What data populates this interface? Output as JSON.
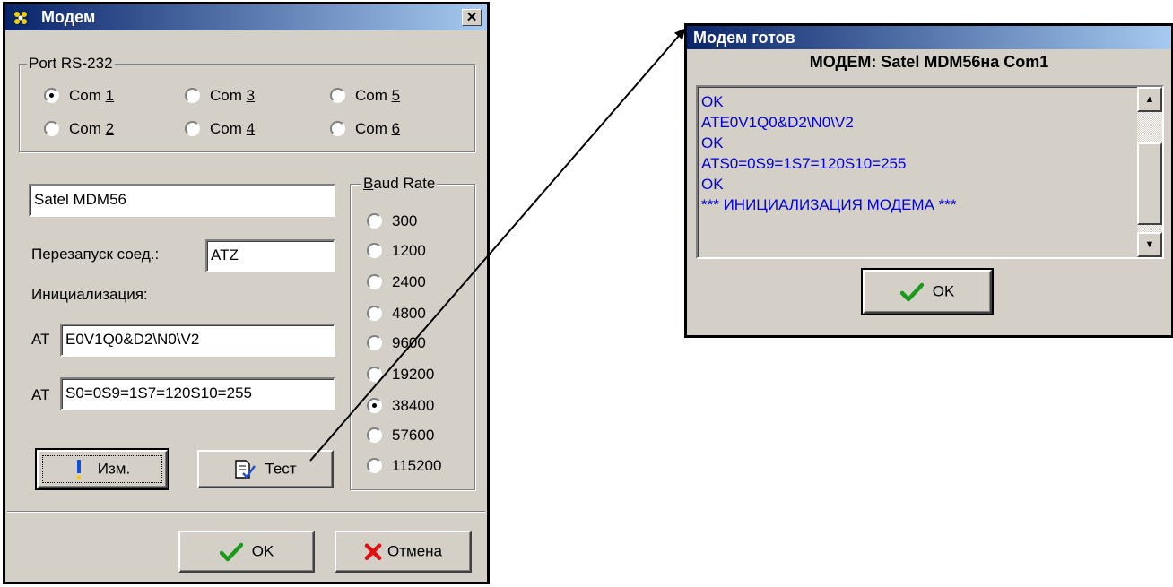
{
  "modem_dialog": {
    "title": "Модем",
    "close_label": "✕",
    "port_group": {
      "legend": "Port RS-232",
      "options": [
        {
          "prefix": "Com ",
          "num": "1",
          "selected": true
        },
        {
          "prefix": "Com ",
          "num": "2",
          "selected": false
        },
        {
          "prefix": "Com ",
          "num": "3",
          "selected": false
        },
        {
          "prefix": "Com ",
          "num": "4",
          "selected": false
        },
        {
          "prefix": "Com ",
          "num": "5",
          "selected": false
        },
        {
          "prefix": "Com ",
          "num": "6",
          "selected": false
        }
      ]
    },
    "modem_name": "Satel MDM56",
    "reset_label": "Перезапуск соед.:",
    "reset_value": "ATZ",
    "init_label": "Инициализация:",
    "at_prefix": "AT",
    "init1_value": "E0V1Q0&D2\\N0\\V2",
    "init2_value": "S0=0S9=1S7=120S10=255",
    "edit_button": "Изм.",
    "test_button": "Тест",
    "baud_group": {
      "legend_first": "B",
      "legend_rest": "aud Rate",
      "rates": [
        "300",
        "1200",
        "2400",
        "4800",
        "9600",
        "19200",
        "38400",
        "57600",
        "115200"
      ],
      "selected": "38400"
    },
    "ok_button": "OK",
    "cancel_button": "Отмена"
  },
  "ready_dialog": {
    "title": "Модем готов",
    "heading": "МОДЕМ: Satel MDM56на Com1",
    "log_lines": [
      "OK",
      "ATE0V1Q0&D2\\N0\\V2",
      "OK",
      "ATS0=0S9=1S7=120S10=255",
      "OK",
      "*** ИНИЦИАЛИЗАЦИЯ МОДЕМА ***"
    ],
    "ok_button": "OK"
  },
  "colors": {
    "face": "#d4d0c8",
    "title_start": "#0a246a",
    "title_end": "#a6caf0",
    "log_text": "#0000e0",
    "ok_check": "#1a9a1a",
    "cancel_x": "#e01010"
  },
  "icons": [
    "modem-app-icon",
    "close-icon",
    "edit-exclamation-icon",
    "test-document-icon",
    "check-icon",
    "cross-icon",
    "scroll-up-icon",
    "scroll-down-icon"
  ]
}
